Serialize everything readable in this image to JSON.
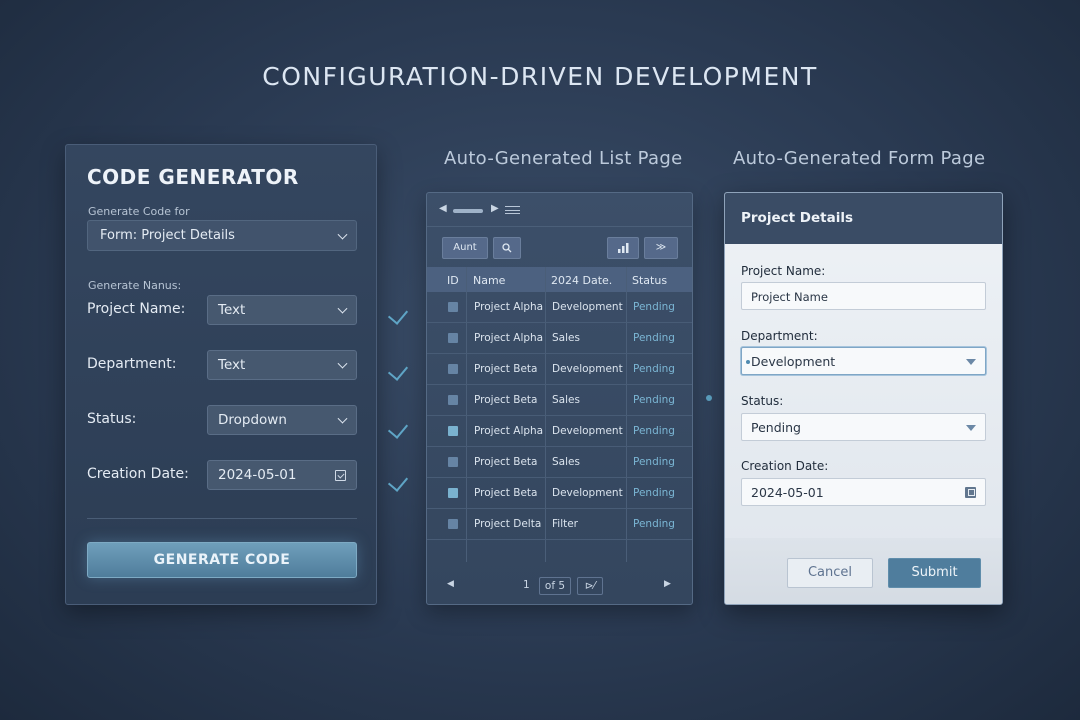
{
  "title": "CONFIGURATION-DRIVEN DEVELOPMENT",
  "generator": {
    "title": "CODE GENERATOR",
    "generate_for_label": "Generate Code for",
    "generate_for_value": "Form: Project Details",
    "fields_label": "Generate Nanus:",
    "fields": [
      {
        "label": "Project Name:",
        "value": "Text"
      },
      {
        "label": "Department:",
        "value": "Text"
      },
      {
        "label": "Status:",
        "value": "Dropdown"
      },
      {
        "label": "Creation Date:",
        "value": "2024-05-01"
      }
    ],
    "button": "GENERATE CODE"
  },
  "list_page": {
    "heading": "Auto-Generated List Page",
    "toolbar": {
      "add_label": "Aunt",
      "sort_label": "≫"
    },
    "columns": [
      "ID",
      "Name",
      "2024 Date.",
      "Status"
    ],
    "rows": [
      {
        "name": "Project Alpha",
        "dept": "Development",
        "status": "Pending"
      },
      {
        "name": "Project Alpha",
        "dept": "Sales",
        "status": "Pending"
      },
      {
        "name": "Project Beta",
        "dept": "Development",
        "status": "Pending"
      },
      {
        "name": "Project Beta",
        "dept": "Sales",
        "status": "Pending"
      },
      {
        "name": "Project Alpha",
        "dept": "Development",
        "status": "Pending"
      },
      {
        "name": "Project Beta",
        "dept": "Sales",
        "status": "Pending"
      },
      {
        "name": "Project Beta",
        "dept": "Development",
        "status": "Pending"
      },
      {
        "name": "Project Delta",
        "dept": "Filter",
        "status": "Pending"
      }
    ],
    "pagination": {
      "current": "1",
      "of_label": "of 5",
      "next_label": "⊳⁄"
    }
  },
  "form_page": {
    "heading": "Auto-Generated Form Page",
    "header": "Project Details",
    "fields": [
      {
        "label": "Project Name:",
        "value": "Project Name"
      },
      {
        "label": "Department:",
        "value": "Development"
      },
      {
        "label": "Status:",
        "value": "Pending"
      },
      {
        "label": "Creation Date:",
        "value": "2024-05-01"
      }
    ],
    "cancel": "Cancel",
    "submit": "Submit"
  }
}
